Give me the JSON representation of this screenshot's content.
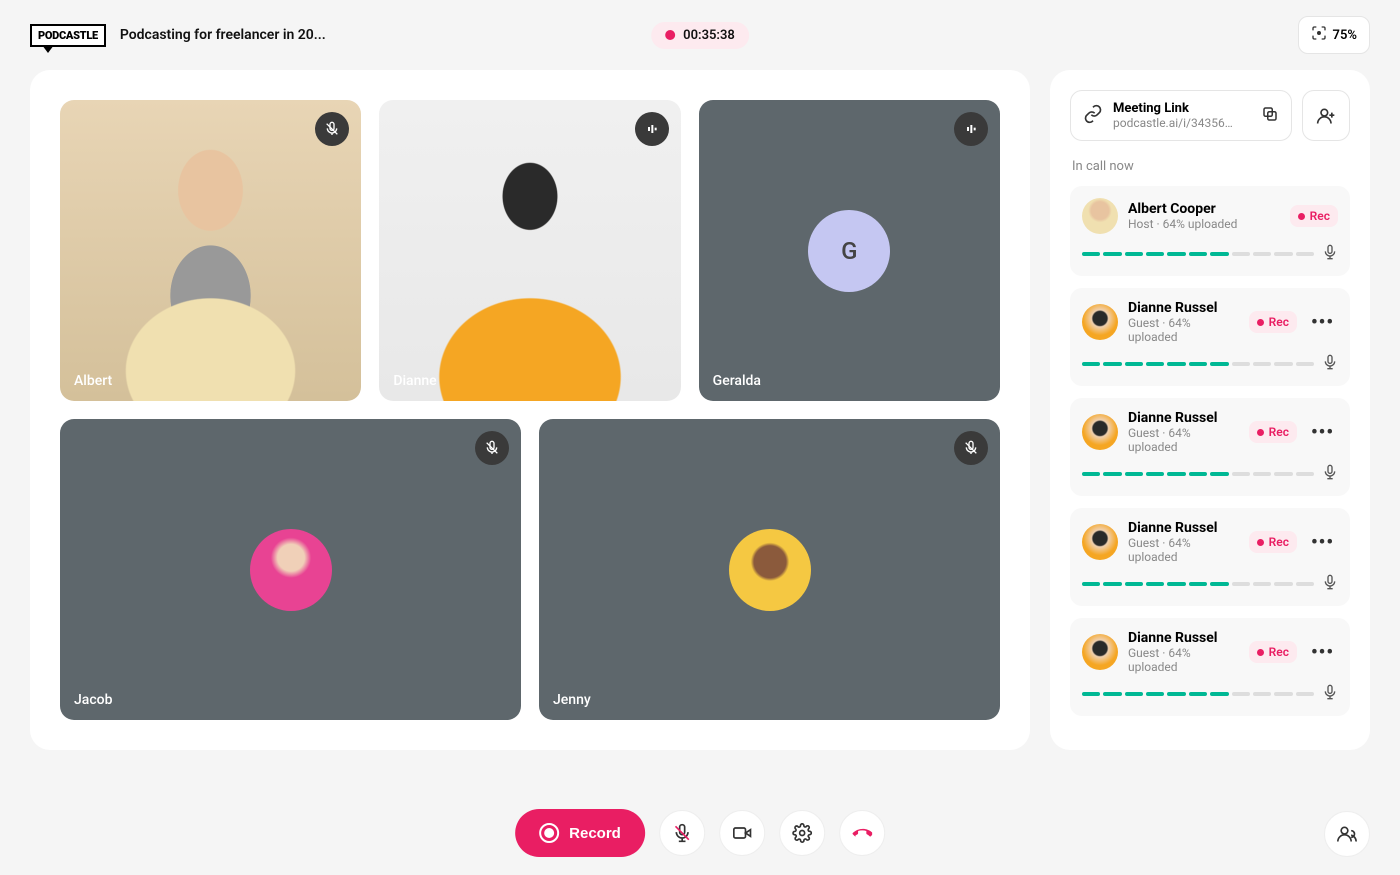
{
  "header": {
    "logo_text": "PODCASTLE",
    "session_title": "Podcasting for freelancer in 20...",
    "timer": "00:35:38",
    "zoom_level": "75%"
  },
  "video_tiles": [
    {
      "name": "Albert",
      "indicator": "mic-muted"
    },
    {
      "name": "Dianne",
      "indicator": "audio-bars"
    },
    {
      "name": "Geralda",
      "indicator": "audio-bars",
      "avatar_letter": "G"
    },
    {
      "name": "Jacob",
      "indicator": "mic-muted"
    },
    {
      "name": "Jenny",
      "indicator": "mic-muted"
    }
  ],
  "sidebar": {
    "meeting_link_label": "Meeting Link",
    "meeting_link_url": "podcastle.ai/i/34356…",
    "in_call_label": "In call now"
  },
  "participants": [
    {
      "name": "Albert Cooper",
      "role": "Host",
      "upload": "64% uploaded",
      "rec": "Rec",
      "has_more": false,
      "segments_filled": 7,
      "segments_total": 11
    },
    {
      "name": "Dianne Russel",
      "role": "Guest",
      "upload": "64% uploaded",
      "rec": "Rec",
      "has_more": true,
      "segments_filled": 7,
      "segments_total": 11
    },
    {
      "name": "Dianne Russel",
      "role": "Guest",
      "upload": "64% uploaded",
      "rec": "Rec",
      "has_more": true,
      "segments_filled": 7,
      "segments_total": 11
    },
    {
      "name": "Dianne Russel",
      "role": "Guest",
      "upload": "64% uploaded",
      "rec": "Rec",
      "has_more": true,
      "segments_filled": 7,
      "segments_total": 11
    },
    {
      "name": "Dianne Russel",
      "role": "Guest",
      "upload": "64% uploaded",
      "rec": "Rec",
      "has_more": true,
      "segments_filled": 7,
      "segments_total": 11
    }
  ],
  "controls": {
    "record_label": "Record"
  },
  "colors": {
    "accent": "#e91e63",
    "teal": "#00b894",
    "avatar_placeholder": "#c5c7f2"
  }
}
